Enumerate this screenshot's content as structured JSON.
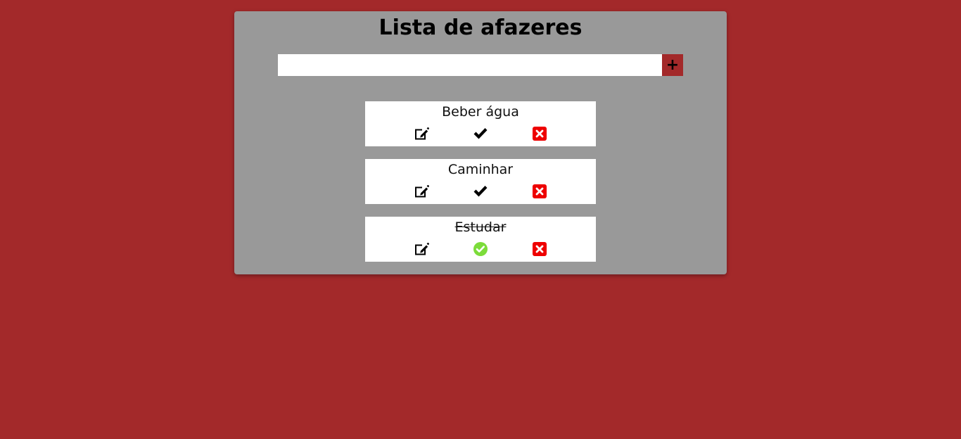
{
  "app": {
    "title": "Lista de afazeres"
  },
  "new_task": {
    "value": "",
    "placeholder": "",
    "add_label": "+"
  },
  "tasks": [
    {
      "text": "Beber água",
      "done": false,
      "actions": [
        "edit-icon",
        "check-icon",
        "delete-icon"
      ]
    },
    {
      "text": "Caminhar",
      "done": false,
      "actions": [
        "edit-icon",
        "check-icon",
        "delete-icon"
      ]
    },
    {
      "text": "Estudar",
      "done": true,
      "actions": [
        "edit-icon",
        "check-circle-icon",
        "delete-icon"
      ]
    }
  ],
  "colors": {
    "background": "#a3292a",
    "panel": "#999999",
    "add_button": "#a3292a",
    "delete_icon": "#ee0000",
    "done_icon": "#7cdc3a"
  }
}
